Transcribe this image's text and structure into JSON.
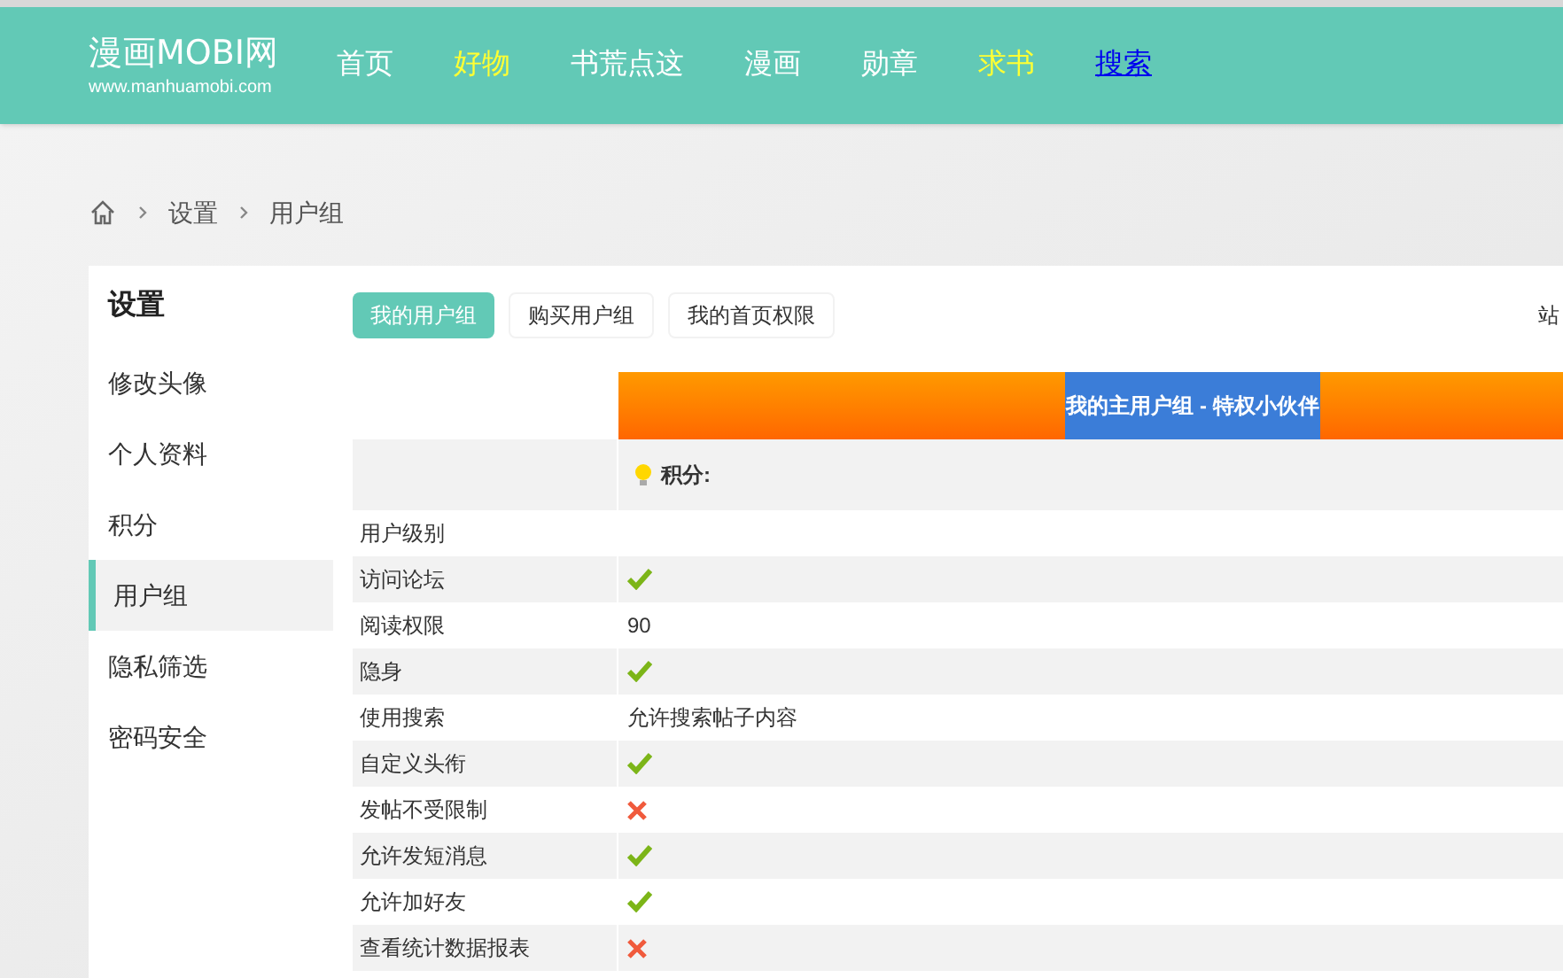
{
  "logo": {
    "title": "漫画MOBI网",
    "url": "www.manhuamobi.com"
  },
  "nav": [
    {
      "label": "首页",
      "color": "#ffffff",
      "kind": "plain"
    },
    {
      "label": "好物",
      "color": "#ffff33",
      "kind": "plain"
    },
    {
      "label": "书荒点这",
      "color": "#ffffff",
      "kind": "plain"
    },
    {
      "label": "漫画",
      "color": "#ffffff",
      "kind": "plain"
    },
    {
      "label": "勋章",
      "color": "#ffffff",
      "kind": "plain"
    },
    {
      "label": "求书",
      "color": "#ffff33",
      "kind": "plain"
    },
    {
      "label": "搜索",
      "color": "#0000ee",
      "kind": "link"
    }
  ],
  "breadcrumb": [
    "设置",
    "用户组"
  ],
  "sidebar": {
    "title": "设置",
    "items": [
      {
        "label": "修改头像",
        "selected": false
      },
      {
        "label": "个人资料",
        "selected": false
      },
      {
        "label": "积分",
        "selected": false
      },
      {
        "label": "用户组",
        "selected": true
      },
      {
        "label": "隐私筛选",
        "selected": false
      },
      {
        "label": "密码安全",
        "selected": false
      }
    ]
  },
  "tabs": [
    {
      "label": "我的用户组",
      "selected": true
    },
    {
      "label": "购买用户组",
      "selected": false
    },
    {
      "label": "我的首页权限",
      "selected": false
    }
  ],
  "right_link": "站",
  "group_header": "我的主用户组 - 特权小伙伴",
  "score_label": "积分:",
  "rows": [
    {
      "label": "用户级别",
      "kind": "blank"
    },
    {
      "label": "访问论坛",
      "kind": "flag",
      "allowed": true
    },
    {
      "label": "阅读权限",
      "kind": "text",
      "value": "90"
    },
    {
      "label": "隐身",
      "kind": "flag",
      "allowed": true
    },
    {
      "label": "使用搜索",
      "kind": "text",
      "value": "允许搜索帖子内容"
    },
    {
      "label": "自定义头衔",
      "kind": "flag",
      "allowed": true
    },
    {
      "label": "发帖不受限制",
      "kind": "flag",
      "allowed": false
    },
    {
      "label": "允许发短消息",
      "kind": "flag",
      "allowed": true
    },
    {
      "label": "允许加好友",
      "kind": "flag",
      "allowed": true
    },
    {
      "label": "查看统计数据报表",
      "kind": "flag",
      "allowed": false
    }
  ]
}
